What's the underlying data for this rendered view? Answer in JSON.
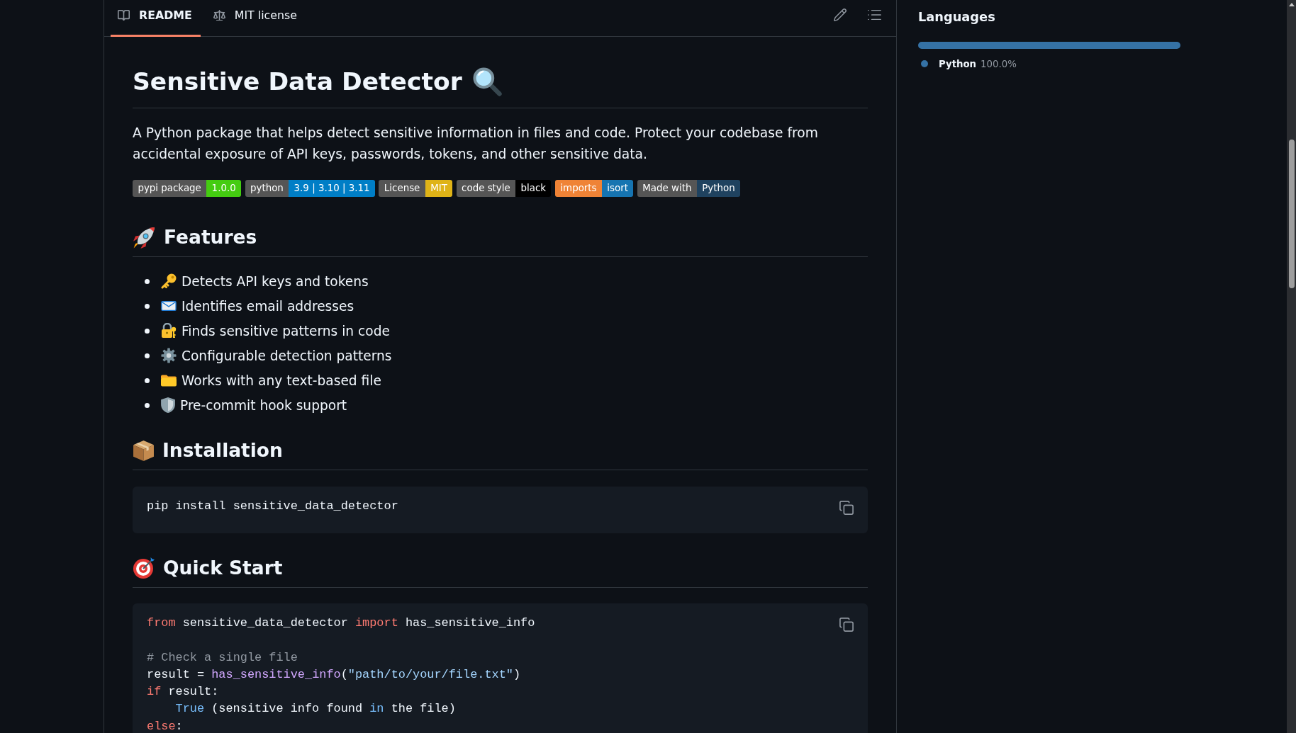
{
  "tabs": [
    {
      "label": "README",
      "selected": true
    },
    {
      "label": "MIT license",
      "selected": false
    }
  ],
  "readme": {
    "title": "Sensitive Data Detector",
    "intro": "A Python package that helps detect sensitive information in files and code. Protect your codebase from accidental exposure of API keys, passwords, tokens, and other sensitive data.",
    "badges": [
      {
        "parts": [
          {
            "text": "pypi package",
            "color": "#555555"
          },
          {
            "text": "1.0.0",
            "color": "#44cc11"
          }
        ]
      },
      {
        "parts": [
          {
            "text": "python",
            "color": "#555555"
          },
          {
            "text": "3.9 | 3.10 | 3.11",
            "color": "#007ec6"
          }
        ]
      },
      {
        "parts": [
          {
            "text": "License",
            "color": "#555555"
          },
          {
            "text": "MIT",
            "color": "#dfb317"
          }
        ]
      },
      {
        "parts": [
          {
            "text": "code style",
            "color": "#555555"
          },
          {
            "text": "black",
            "color": "#000000"
          }
        ]
      },
      {
        "parts": [
          {
            "text": "imports",
            "color": "#ef8336"
          },
          {
            "text": "isort",
            "color": "#1674b1"
          }
        ]
      },
      {
        "parts": [
          {
            "text": "Made with",
            "color": "#555555"
          },
          {
            "text": "Python",
            "color": "#1f425f"
          }
        ]
      }
    ],
    "sections": [
      {
        "kind": "list",
        "heading": "Features",
        "items": [
          "Detects API keys and tokens",
          "Identifies email addresses",
          "Finds sensitive patterns in code",
          "Configurable detection patterns",
          "Works with any text-based file",
          "Pre-commit hook support"
        ]
      },
      {
        "kind": "code",
        "heading": "Installation",
        "code": {
          "groups": [
            {
              "lines": [
                {
                  "tokens": [
                    {
                      "text": "pip install sensitive_data_detector",
                      "kind": "plain"
                    }
                  ]
                }
              ]
            }
          ]
        }
      },
      {
        "kind": "code",
        "heading": "Quick Start",
        "code": {
          "groups": [
            {
              "lines": [
                {
                  "tokens": [
                    {
                      "text": "from",
                      "kind": "keyword"
                    },
                    {
                      "text": " sensitive_data_detector ",
                      "kind": "plain"
                    },
                    {
                      "text": "import",
                      "kind": "keyword"
                    },
                    {
                      "text": " has_sensitive_info",
                      "kind": "plain"
                    }
                  ]
                }
              ]
            },
            {
              "lines": [
                {
                  "tokens": [
                    {
                      "text": "# Check a single file",
                      "kind": "comment"
                    }
                  ]
                },
                {
                  "tokens": [
                    {
                      "text": "result = ",
                      "kind": "plain"
                    },
                    {
                      "text": "has_sensitive_info",
                      "kind": "function"
                    },
                    {
                      "text": "(",
                      "kind": "plain"
                    },
                    {
                      "text": "\"path/to/your/file.txt\"",
                      "kind": "string"
                    },
                    {
                      "text": ")",
                      "kind": "plain"
                    }
                  ]
                },
                {
                  "tokens": [
                    {
                      "text": "if",
                      "kind": "keyword"
                    },
                    {
                      "text": " result:",
                      "kind": "plain"
                    }
                  ],
                  "children": [
                    {
                      "tokens": [
                        {
                          "text": "True",
                          "kind": "constant"
                        },
                        {
                          "text": " (sensitive info found ",
                          "kind": "plain"
                        },
                        {
                          "text": "in",
                          "kind": "constant"
                        },
                        {
                          "text": " the file)",
                          "kind": "plain"
                        }
                      ]
                    }
                  ]
                },
                {
                  "tokens": [
                    {
                      "text": "else",
                      "kind": "keyword"
                    },
                    {
                      "text": ":",
                      "kind": "plain"
                    }
                  ]
                }
              ]
            }
          ]
        }
      }
    ]
  },
  "sidebar": {
    "languages": {
      "title": "Languages",
      "items": [
        {
          "name": "Python",
          "percent": "100.0%",
          "color": "#3572a5"
        }
      ]
    }
  }
}
